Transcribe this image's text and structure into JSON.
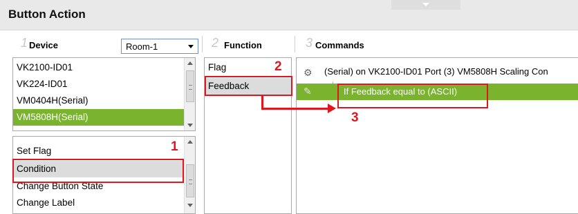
{
  "window": {
    "title": "Button Action"
  },
  "columns": {
    "device": {
      "number": "1",
      "title": "Device"
    },
    "function": {
      "number": "2",
      "title": "Function"
    },
    "commands": {
      "number": "3",
      "title": "Commands"
    }
  },
  "room_select": {
    "value": "Room-1"
  },
  "devices": [
    "VK2100-ID01",
    "VK224-ID01",
    "VM0404H(Serial)",
    "VM5808H(Serial)"
  ],
  "actions": [
    "Set Flag",
    "Condition",
    "Change Button State",
    "Change Label"
  ],
  "functions": [
    "Flag",
    "Feedback"
  ],
  "commands": [
    {
      "text": "(Serial) on VK2100-ID01 Port (3) VM5808H Scaling Con",
      "icon": "serial-command-icon"
    },
    {
      "text": "If Feedback equal to (ASCII)",
      "icon": "pencil-icon"
    }
  ],
  "annotations": {
    "step1": "1",
    "step2": "2",
    "step3": "3"
  },
  "colors": {
    "selection": "#7ab32e",
    "highlight": "#dcdcdc",
    "annotation": "#e0161e"
  }
}
